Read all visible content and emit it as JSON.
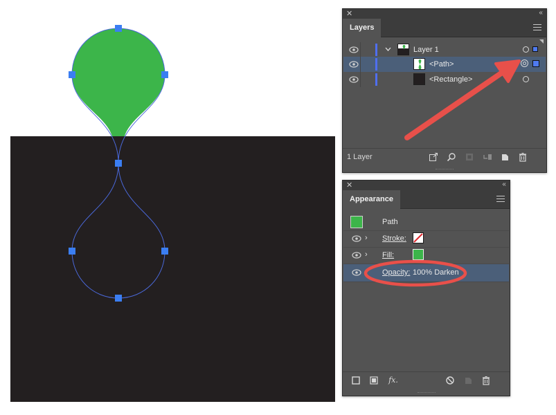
{
  "layers_panel": {
    "title": "Layers",
    "rows": [
      {
        "name": "Layer 1",
        "has_chevron": true,
        "selected": false
      },
      {
        "name": "<Path>",
        "selected": true
      },
      {
        "name": "<Rectangle>",
        "selected": false
      }
    ],
    "footer_count": "1 Layer",
    "icons": [
      "eye-icon",
      "disclosure-chevron-icon",
      "target-circle-icon",
      "selection-square-icon",
      "export-icon",
      "locate-object-icon",
      "clipping-mask-icon",
      "new-sublayer-icon",
      "new-layer-icon",
      "trash-icon"
    ]
  },
  "appearance_panel": {
    "title": "Appearance",
    "object_label": "Path",
    "stroke_label": "Stroke:",
    "fill_label": "Fill:",
    "opacity_label": "Opacity:",
    "opacity_value": "100% Darken",
    "fx_label": "fx.",
    "icons": [
      "add-stroke-icon",
      "add-fill-icon",
      "fx-icon",
      "clear-appearance-icon",
      "duplicate-item-icon",
      "trash-icon"
    ]
  },
  "colors": {
    "shape_fill": "#3cb54a",
    "artboard_dark": "#231f20",
    "anchor_blue": "#3b7ef2",
    "path_outline": "#4a68d9",
    "annotation_red": "#e8504a",
    "panel_bg": "#535353",
    "selected_row": "#4b5f79"
  }
}
